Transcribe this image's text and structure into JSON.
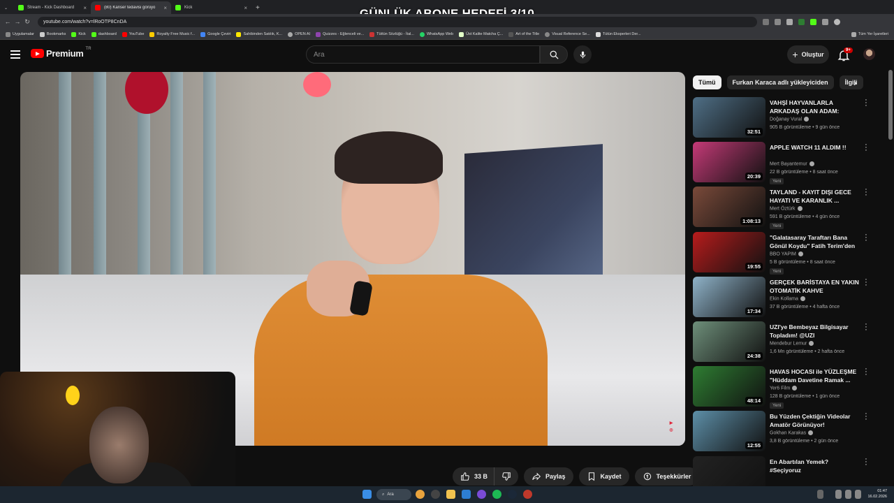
{
  "overlay_title": "GÜNLÜK ABONE HEDEFİ 3/10",
  "browser": {
    "tabs": [
      {
        "label": "Stream - Kick Dashboard",
        "color": "#53fc18",
        "active": false
      },
      {
        "label": "(80) Kanser tedavisi görüyo",
        "color": "#ff0000",
        "active": true
      },
      {
        "label": "Kick",
        "color": "#53fc18",
        "active": false
      }
    ],
    "url": "youtube.com/watch?v=lRoOTP8CnDA",
    "bookmarks": [
      {
        "label": "Uygulamalar",
        "color": "#888"
      },
      {
        "label": "Bookmarks",
        "color": "#ccc"
      },
      {
        "label": "Kick",
        "color": "#53fc18"
      },
      {
        "label": "dashboard",
        "color": "#53fc18"
      },
      {
        "label": "YouTube",
        "color": "#ff0000"
      },
      {
        "label": "Royalty Free Music f...",
        "color": "#ffcc00"
      },
      {
        "label": "Google Çeviri",
        "color": "#4285f4"
      },
      {
        "label": "Sahibinden Satılık, K...",
        "color": "#ffe800"
      },
      {
        "label": "OPEN AI",
        "color": "#aaa"
      },
      {
        "label": "Quizzes - Eğlenceli ve...",
        "color": "#8e44ad"
      },
      {
        "label": "Tüttün Sözlüğü - İtal...",
        "color": "#cc3333"
      },
      {
        "label": "WhatsApp Web",
        "color": "#25d366"
      },
      {
        "label": "Üst Kalite Matcha Ç...",
        "color": "#e2ffc8"
      },
      {
        "label": "Art of the Title",
        "color": "#555"
      },
      {
        "label": "Visual Reference Se...",
        "color": "#888"
      },
      {
        "label": "Tütün Eksperleri Der...",
        "color": "#ddd"
      }
    ],
    "bookmarks_right": "Tüm Yer İşaretleri"
  },
  "youtube": {
    "logo_text": "Premium",
    "logo_region": "TR",
    "search_placeholder": "Ara",
    "create_label": "Oluştur",
    "notification_count": "9+"
  },
  "video_actions": {
    "likes": "33 B",
    "share": "Paylaş",
    "save": "Kaydet",
    "thanks": "Teşekkürler"
  },
  "chips": [
    "Tümü",
    "Furkan Karaca adlı yükleyiciden",
    "İlgili"
  ],
  "recommendations": [
    {
      "title": "VAHŞİ HAYVANLARLA ARKADAŞ OLAN ADAM: ÇOBA...",
      "channel": "Doğanay Vural",
      "meta": "905 B görüntüleme • 9 gün önce",
      "duration": "32:51",
      "badge": "",
      "thumb": "#4f6f86"
    },
    {
      "title": "APPLE WATCH 11 ALDIM !!",
      "channel": "Mert Bayantemur",
      "meta": "22 B görüntüleme • 8 saat önce",
      "duration": "20:39",
      "badge": "Yeni",
      "thumb": "#c43a77"
    },
    {
      "title": "TAYLAND - KAYIT DIŞI GECE HAYATI VE KARANLIK ...",
      "channel": "Mert Öztürk",
      "meta": "591 B görüntüleme • 4 gün önce",
      "duration": "1:08:13",
      "badge": "Yeni",
      "thumb": "#7a4a3a"
    },
    {
      "title": "\"Galatasaray Taraftarı Bana Gönül Koydu\" Fatih Terim'den ...",
      "channel": "BBO YAPIM",
      "meta": "5 B görüntüleme • 8 saat önce",
      "duration": "19:55",
      "badge": "Yeni",
      "thumb": "#b71c1c"
    },
    {
      "title": "GERÇEK BARİSTAYA EN YAKIN OTOMATİK KAHVE MAKİNESİ!...",
      "channel": "Ekin Kollama",
      "meta": "37 B görüntüleme • 4 hafta önce",
      "duration": "17:34",
      "badge": "",
      "thumb": "#8fb3c9"
    },
    {
      "title": "UZI'ye Bembeyaz Bilgisayar Topladım! @UZI",
      "channel": "Mendebur Lemur",
      "meta": "1,6 Mn görüntüleme • 2 hafta önce",
      "duration": "24:38",
      "badge": "",
      "thumb": "#6e8f7a"
    },
    {
      "title": "HAVAS HOCASI ile YÜZLEŞME \"Hüddam Davetine Ramak ...",
      "channel": "Yer6 Film",
      "meta": "128 B görüntüleme • 1 gün önce",
      "duration": "48:14",
      "badge": "Yeni",
      "thumb": "#2e7d32"
    },
    {
      "title": "Bu Yüzden Çektiğin Videolar Amatör Görünüyor!",
      "channel": "Gokhan Karakas",
      "meta": "3,8 B görüntüleme • 2 gün önce",
      "duration": "12:55",
      "badge": "",
      "thumb": "#5d8fa8"
    },
    {
      "title": "En Abartılan Yemek? #Seçiyoruz",
      "channel": "",
      "meta": "",
      "duration": "",
      "badge": "",
      "thumb": "#222"
    }
  ],
  "taskbar": {
    "search_label": "Ara",
    "time": "01:47",
    "date": "16.02.2026"
  }
}
